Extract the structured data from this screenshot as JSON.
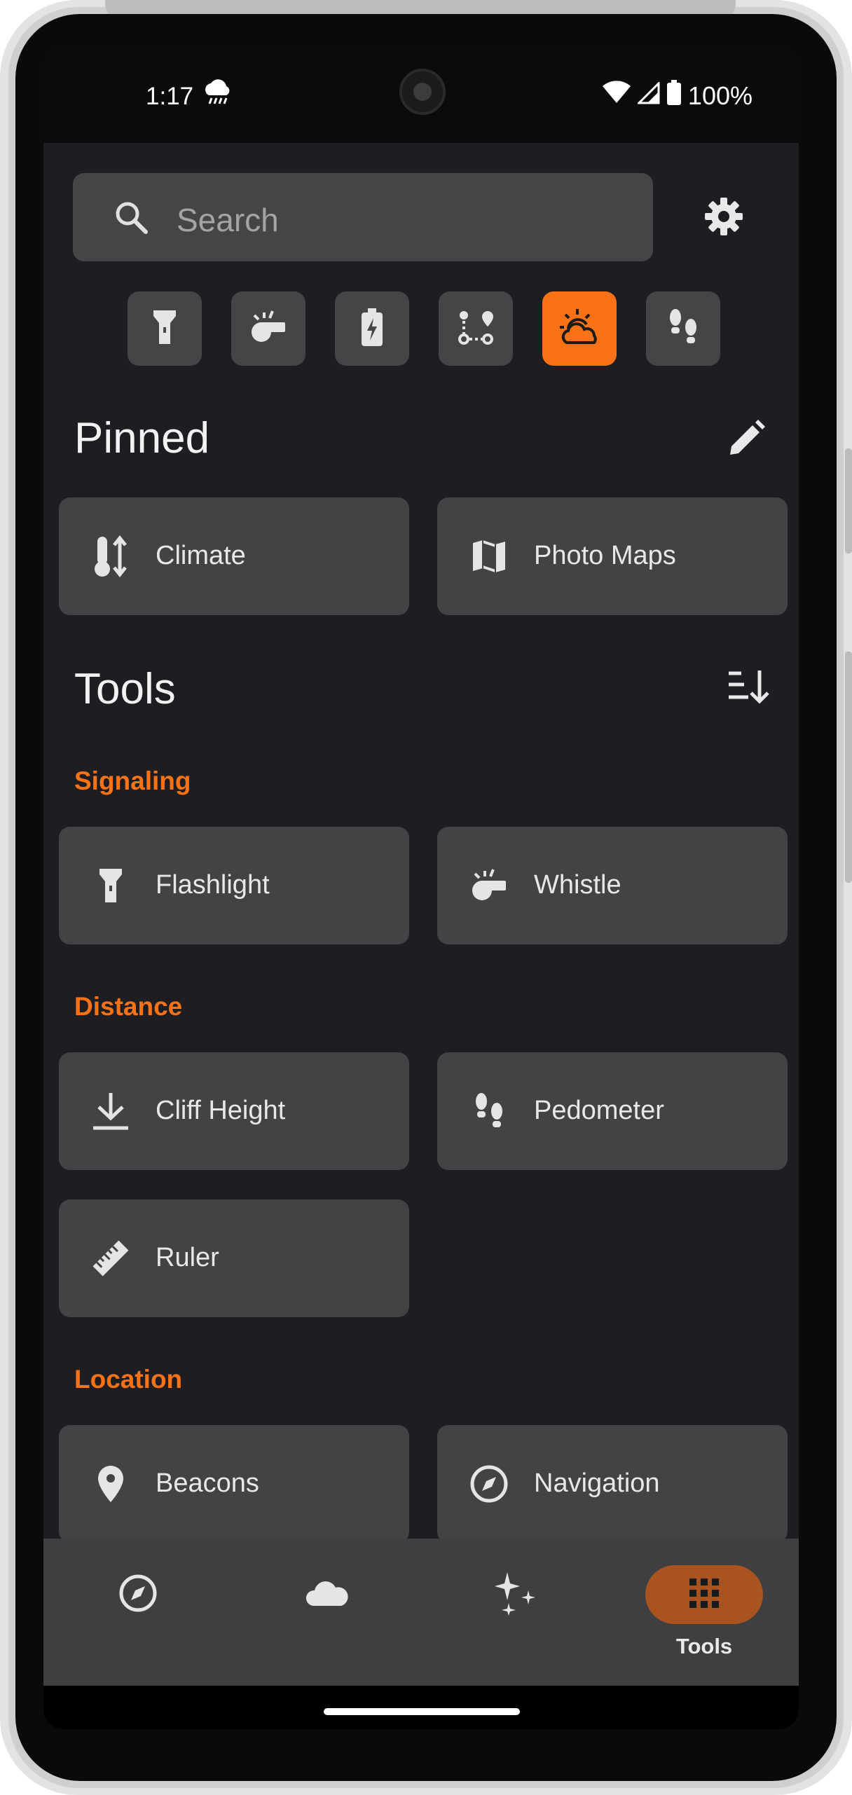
{
  "status_bar": {
    "time": "1:17",
    "battery": "100%"
  },
  "search": {
    "placeholder": "Search"
  },
  "quick_actions": [
    "flashlight-icon",
    "whistle-icon",
    "battery-icon",
    "route-icon",
    "weather-icon",
    "pedometer-icon"
  ],
  "pinned": {
    "title": "Pinned",
    "items": [
      {
        "label": "Climate",
        "icon": "thermometer-icon"
      },
      {
        "label": "Photo Maps",
        "icon": "map-icon"
      }
    ]
  },
  "tools": {
    "title": "Tools",
    "categories": [
      {
        "name": "Signaling",
        "items": [
          {
            "label": "Flashlight",
            "icon": "flashlight-icon"
          },
          {
            "label": "Whistle",
            "icon": "whistle-icon"
          }
        ]
      },
      {
        "name": "Distance",
        "items": [
          {
            "label": "Cliff Height",
            "icon": "download-arrow-icon"
          },
          {
            "label": "Pedometer",
            "icon": "pedometer-icon"
          },
          {
            "label": "Ruler",
            "icon": "ruler-icon"
          }
        ]
      },
      {
        "name": "Location",
        "items": [
          {
            "label": "Beacons",
            "icon": "location-pin-icon"
          },
          {
            "label": "Navigation",
            "icon": "compass-icon"
          }
        ]
      }
    ]
  },
  "bottom_nav": {
    "items": [
      {
        "icon": "compass-icon",
        "label": ""
      },
      {
        "icon": "cloud-icon",
        "label": ""
      },
      {
        "icon": "sparkle-icon",
        "label": ""
      },
      {
        "icon": "grid-icon",
        "label": "Tools"
      }
    ],
    "active_index": 3
  },
  "colors": {
    "accent": "#f97316",
    "background": "#1e1e22",
    "card": "#434345",
    "nav_active": "#a85320"
  }
}
